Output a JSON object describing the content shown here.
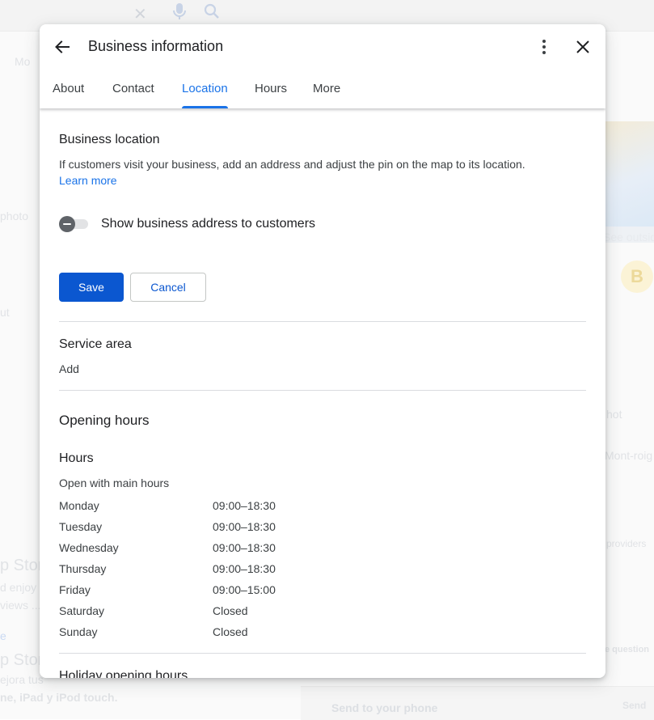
{
  "background": {
    "texts": [
      "Mo",
      "photo",
      "ut",
      "hot",
      "Mont-roig",
      "providers",
      "e question",
      "See outsid",
      "p Stor",
      "d enjoy",
      "views ...",
      "e",
      "p Stor",
      "ejora tus",
      "ne, iPad y iPod touch.",
      "Send to your phone",
      "Send"
    ]
  },
  "dialog": {
    "title": "Business information",
    "tabs": [
      {
        "label": "About"
      },
      {
        "label": "Contact"
      },
      {
        "label": "Location"
      },
      {
        "label": "Hours"
      },
      {
        "label": "More"
      }
    ],
    "active_tab": "Location",
    "location": {
      "title": "Business location",
      "description": "If customers visit your business, add an address and adjust the pin on the map to its location.",
      "learn_more": "Learn more",
      "toggle_label": "Show business address to customers",
      "toggle_on": false,
      "save_label": "Save",
      "cancel_label": "Cancel"
    },
    "service_area": {
      "title": "Service area",
      "add_label": "Add"
    },
    "opening_hours": {
      "title": "Opening hours",
      "hours_title": "Hours",
      "status": "Open with main hours",
      "days": [
        {
          "day": "Monday",
          "time": "09:00–18:30"
        },
        {
          "day": "Tuesday",
          "time": "09:00–18:30"
        },
        {
          "day": "Wednesday",
          "time": "09:00–18:30"
        },
        {
          "day": "Thursday",
          "time": "09:00–18:30"
        },
        {
          "day": "Friday",
          "time": "09:00–15:00"
        },
        {
          "day": "Saturday",
          "time": "Closed"
        },
        {
          "day": "Sunday",
          "time": "Closed"
        }
      ],
      "holiday_title": "Holiday opening hours"
    }
  },
  "colors": {
    "accent": "#1a73e8",
    "primary_button": "#0b57d0",
    "text": "#202124",
    "divider": "#dadce0"
  }
}
